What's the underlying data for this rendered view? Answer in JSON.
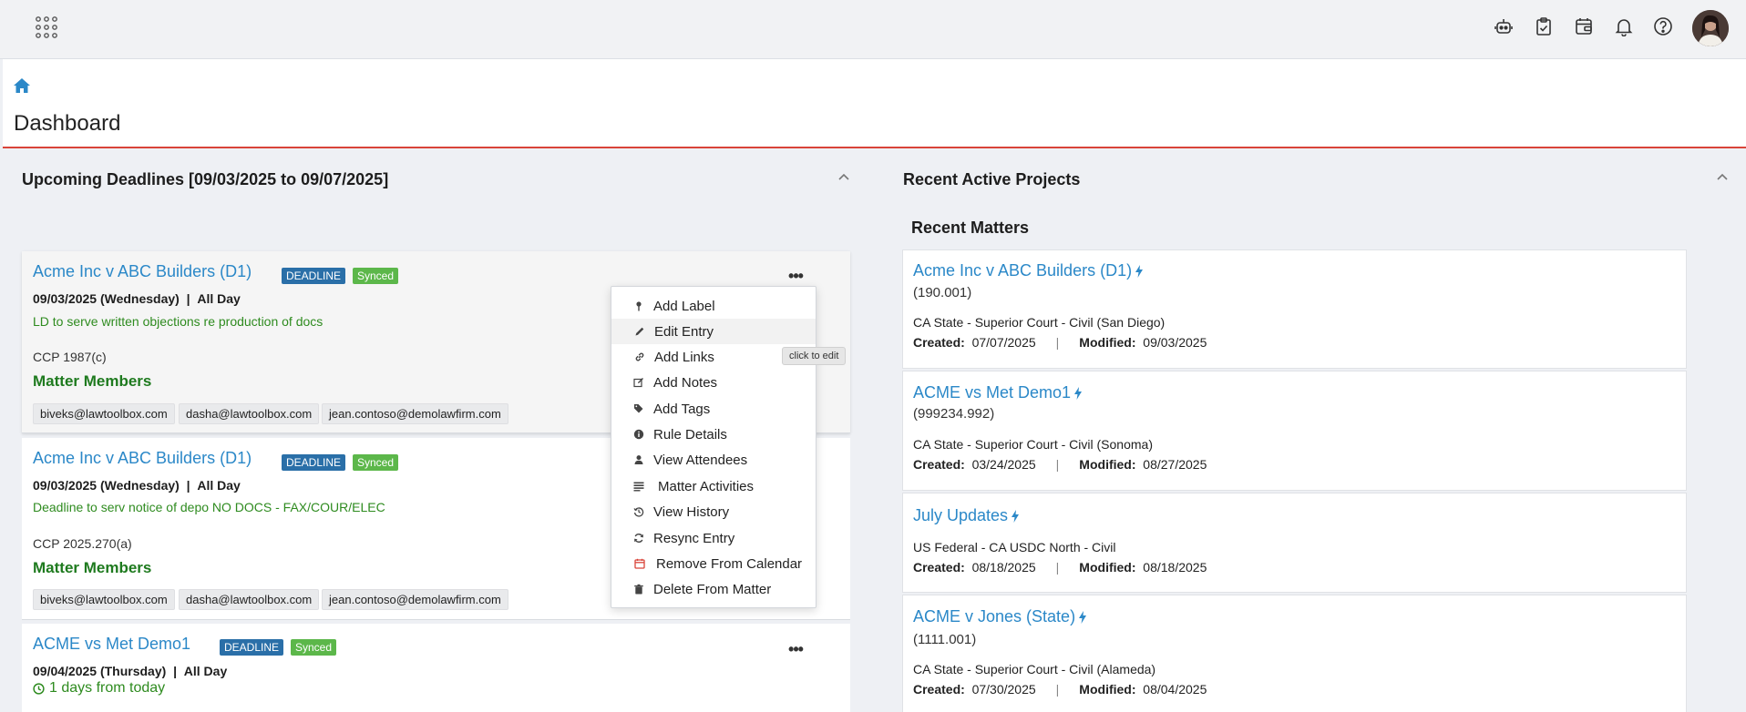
{
  "topbar": {
    "icons": [
      "app-grid-icon",
      "robot-icon",
      "clipboard-check-icon",
      "calendar-wallet-icon",
      "bell-icon",
      "help-icon"
    ],
    "avatar": "user-avatar"
  },
  "header": {
    "title": "Dashboard",
    "home_icon": "home-icon"
  },
  "deadlines": {
    "title": "Upcoming Deadlines [09/03/2025 to 09/07/2025]",
    "cards": [
      {
        "matter": "Acme Inc v ABC Builders (D1)",
        "badge_type": "DEADLINE",
        "badge_sync": "Synced",
        "date": "09/03/2025 (Wednesday)",
        "sep": "|",
        "time": "All Day",
        "description": "LD to serve written objections re production of docs",
        "rule": "CCP 1987(c)",
        "members_label": "Matter Members",
        "members": [
          "biveks@lawtoolbox.com",
          "dasha@lawtoolbox.com",
          "jean.contoso@demolawfirm.com"
        ],
        "more": "•••"
      },
      {
        "matter": "Acme Inc v ABC Builders (D1)",
        "badge_type": "DEADLINE",
        "badge_sync": "Synced",
        "date": "09/03/2025 (Wednesday)",
        "sep": "|",
        "time": "All Day",
        "description": "Deadline to serv notice of depo NO DOCS - FAX/COUR/ELEC",
        "rule": "CCP 2025.270(a)",
        "members_label": "Matter Members",
        "members": [
          "biveks@lawtoolbox.com",
          "dasha@lawtoolbox.com",
          "jean.contoso@demolawfirm.com"
        ]
      },
      {
        "matter": "ACME vs Met Demo1",
        "badge_type": "DEADLINE",
        "badge_sync": "Synced",
        "date": "09/04/2025 (Thursday)",
        "sep": "|",
        "time": "All Day",
        "days": "1 days from today",
        "more": "•••"
      }
    ]
  },
  "context_menu": {
    "items": [
      {
        "label": "Add Label",
        "icon": "pin-icon"
      },
      {
        "label": "Edit Entry",
        "icon": "pencil-icon"
      },
      {
        "label": "Add Links",
        "icon": "link-icon"
      },
      {
        "label": "Add Notes",
        "icon": "note-edit-icon"
      },
      {
        "label": "Add Tags",
        "icon": "tags-icon"
      },
      {
        "label": "Rule Details",
        "icon": "info-icon"
      },
      {
        "label": "View Attendees",
        "icon": "user-icon"
      },
      {
        "label": "Matter Activities",
        "icon": "list-icon"
      },
      {
        "label": "View History",
        "icon": "history-icon"
      },
      {
        "label": "Resync Entry",
        "icon": "refresh-icon"
      },
      {
        "label": "Remove From Calendar",
        "icon": "calendar-remove-icon"
      },
      {
        "label": "Delete From Matter",
        "icon": "trash-icon"
      }
    ],
    "tooltip": "click to edit"
  },
  "projects": {
    "title": "Recent Active Projects",
    "subtitle": "Recent Matters",
    "created_label": "Created:",
    "modified_label": "Modified:",
    "sep": "|",
    "matters": [
      {
        "name": "Acme Inc v ABC Builders (D1)",
        "number": "(190.001)",
        "court": "CA State - Superior Court - Civil (San Diego)",
        "created": "07/07/2025",
        "modified": "09/03/2025"
      },
      {
        "name": "ACME vs Met Demo1",
        "number": "(999234.992)",
        "court": "CA State - Superior Court - Civil (Sonoma)",
        "created": "03/24/2025",
        "modified": "08/27/2025"
      },
      {
        "name": "July Updates",
        "number": "",
        "court": "US Federal - CA USDC North - Civil",
        "created": "08/18/2025",
        "modified": "08/18/2025"
      },
      {
        "name": "ACME v Jones (State)",
        "number": "(1111.001)",
        "court": "CA State - Superior Court - Civil (Alameda)",
        "created": "07/30/2025",
        "modified": "08/04/2025"
      }
    ]
  }
}
